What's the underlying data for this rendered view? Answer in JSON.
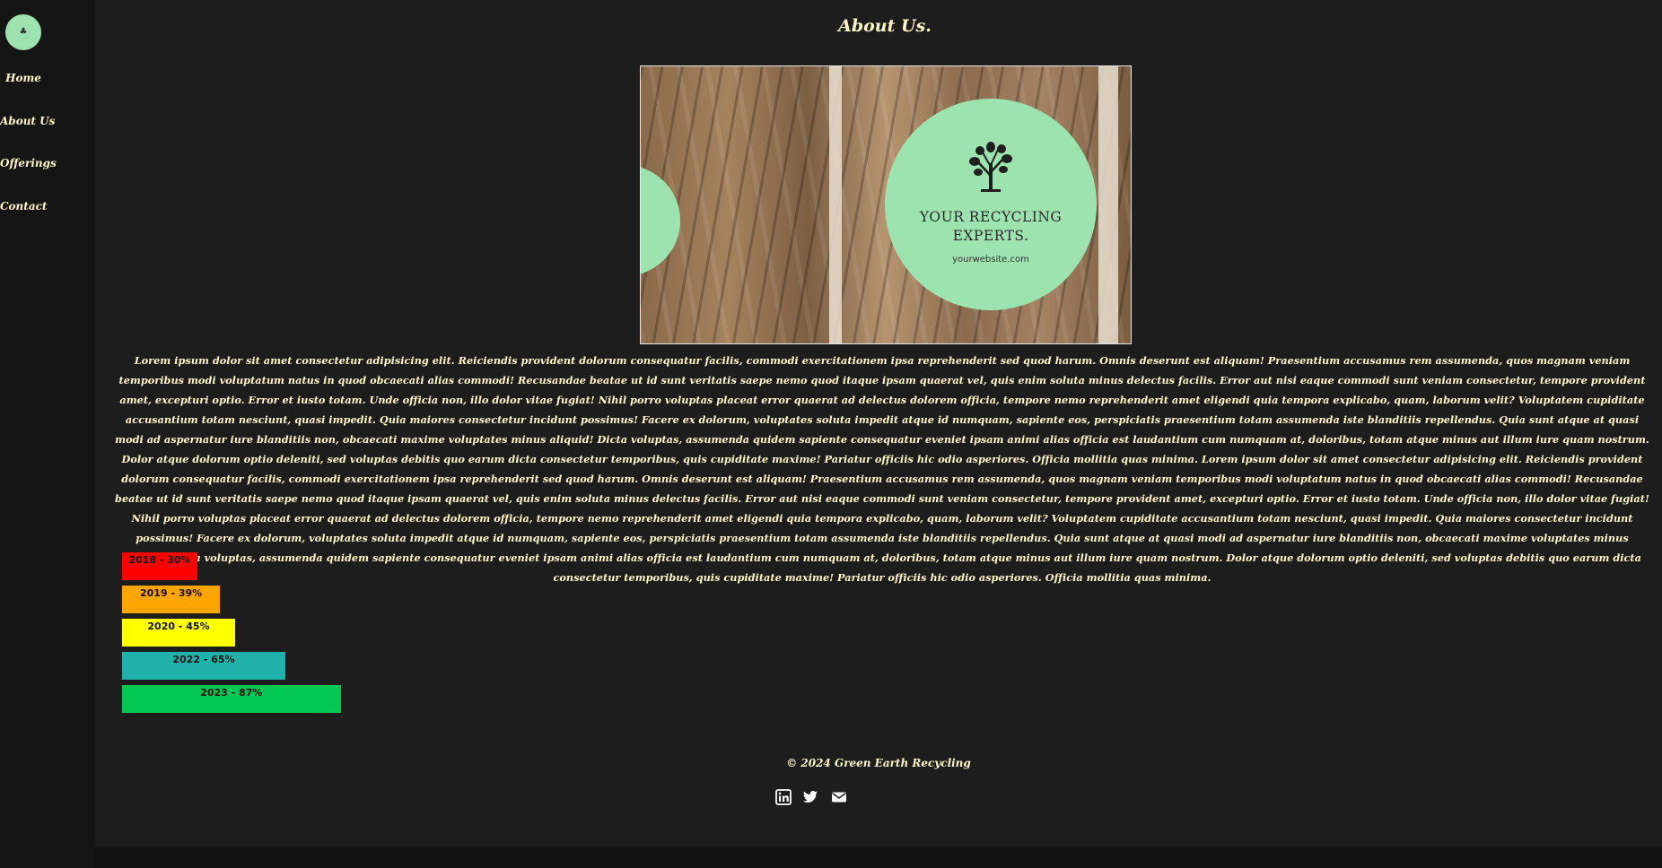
{
  "sidebar": {
    "logo_icon": "tree-logo-icon",
    "items": [
      {
        "label": "Home"
      },
      {
        "label": "About Us"
      },
      {
        "label": "Offerings"
      },
      {
        "label": "Contact"
      }
    ]
  },
  "main": {
    "title": "About Us.",
    "hero": {
      "tagline": "YOUR RECYCLING EXPERTS.",
      "website": "yourwebsite.com",
      "circle_color": "#9de3b0"
    },
    "paragraph": "Lorem ipsum dolor sit amet consectetur adipisicing elit. Reiciendis provident dolorum consequatur facilis, commodi exercitationem ipsa reprehenderit sed quod harum. Omnis deserunt est aliquam! Praesentium accusamus rem assumenda, quos magnam veniam temporibus modi voluptatum natus in quod obcaecati alias commodi! Recusandae beatae ut id sunt veritatis saepe nemo quod itaque ipsam quaerat vel, quis enim soluta minus delectus facilis. Error aut nisi eaque commodi sunt veniam consectetur, tempore provident amet, excepturi optio. Error et iusto totam. Unde officia non, illo dolor vitae fugiat! Nihil porro voluptas placeat error quaerat ad delectus dolorem officia, tempore nemo reprehenderit amet eligendi quia tempora explicabo, quam, laborum velit? Voluptatem cupiditate accusantium totam nesciunt, quasi impedit. Quia maiores consectetur incidunt possimus! Facere ex dolorum, voluptates soluta impedit atque id numquam, sapiente eos, perspiciatis praesentium totam assumenda iste blanditiis repellendus. Quia sunt atque at quasi modi ad aspernatur iure blanditiis non, obcaecati maxime voluptates minus aliquid! Dicta voluptas, assumenda quidem sapiente consequatur eveniet ipsam animi alias officia est laudantium cum numquam at, doloribus, totam atque minus aut illum iure quam nostrum. Dolor atque dolorum optio deleniti, sed voluptas debitis quo earum dicta consectetur temporibus, quis cupiditate maxime! Pariatur officiis hic odio asperiores. Officia mollitia quas minima. Lorem ipsum dolor sit amet consectetur adipisicing elit. Reiciendis provident dolorum consequatur facilis, commodi exercitationem ipsa reprehenderit sed quod harum. Omnis deserunt est aliquam! Praesentium accusamus rem assumenda, quos magnam veniam temporibus modi voluptatum natus in quod obcaecati alias commodi! Recusandae beatae ut id sunt veritatis saepe nemo quod itaque ipsam quaerat vel, quis enim soluta minus delectus facilis. Error aut nisi eaque commodi sunt veniam consectetur, tempore provident amet, excepturi optio. Error et iusto totam. Unde officia non, illo dolor vitae fugiat! Nihil porro voluptas placeat error quaerat ad delectus dolorem officia, tempore nemo reprehenderit amet eligendi quia tempora explicabo, quam, laborum velit? Voluptatem cupiditate accusantium totam nesciunt, quasi impedit. Quia maiores consectetur incidunt possimus! Facere ex dolorum, voluptates soluta impedit atque id numquam, sapiente eos, perspiciatis praesentium totam assumenda iste blanditiis repellendus. Quia sunt atque at quasi modi ad aspernatur iure blanditiis non, obcaecati maxime voluptates minus aliquid! Dicta voluptas, assumenda quidem sapiente consequatur eveniet ipsam animi alias officia est laudantium cum numquam at, doloribus, totam atque minus aut illum iure quam nostrum. Dolor atque dolorum optio deleniti, sed voluptas debitis quo earum dicta consectetur temporibus, quis cupiditate maxime! Pariatur officiis hic odio asperiores. Officia mollitia quas minima.",
    "progress_bars": [
      {
        "label": "2018 - 30%",
        "value": 30,
        "color": "#ff0000"
      },
      {
        "label": "2019 - 39%",
        "value": 39,
        "color": "#ffa500"
      },
      {
        "label": "2020 - 45%",
        "value": 45,
        "color": "#ffff00"
      },
      {
        "label": "2022 - 65%",
        "value": 65,
        "color": "#20b2aa"
      },
      {
        "label": "2023 - 87%",
        "value": 87,
        "color": "#00c853"
      }
    ]
  },
  "footer": {
    "copyright": "© 2024 Green Earth Recycling",
    "social_icons": [
      "linkedin-icon",
      "twitter-icon",
      "email-icon"
    ]
  },
  "colors": {
    "text": "#fff6c8",
    "background": "#1d1d1d",
    "sidebar": "#151515",
    "accent": "#9de3b0"
  }
}
